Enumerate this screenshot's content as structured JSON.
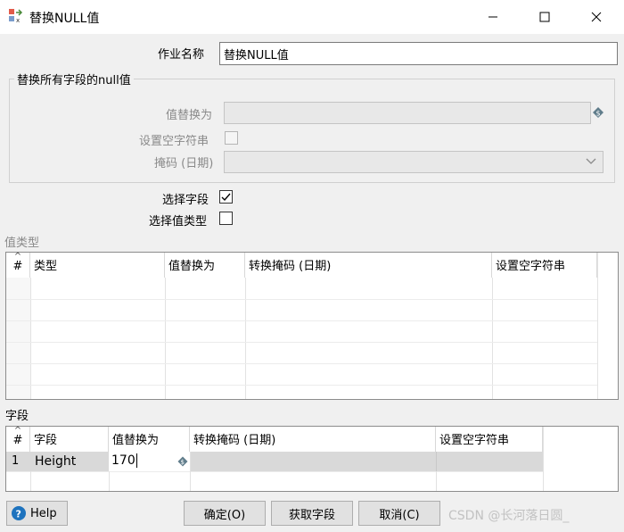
{
  "window": {
    "title": "替换NULL值",
    "icon": "pentaho-step-icon",
    "minimize_icon": "minimize-icon",
    "maximize_icon": "maximize-icon",
    "close_icon": "close-icon"
  },
  "job_name": {
    "label": "作业名称",
    "value": "替换NULL值"
  },
  "group_all_fields": {
    "legend": "替换所有字段的null值",
    "replace_value_label": "值替换为",
    "replace_value": "",
    "set_empty_label": "设置空字符串",
    "set_empty_checked": false,
    "mask_label": "掩码 (日期)",
    "mask_value": ""
  },
  "select_fields": {
    "label": "选择字段",
    "checked": true
  },
  "select_value_types": {
    "label": "选择值类型",
    "checked": false
  },
  "value_types_section": {
    "title": "值类型",
    "columns": [
      "#",
      "类型",
      "值替换为",
      "转换掩码 (日期)",
      "设置空字符串"
    ],
    "rows": []
  },
  "fields_section": {
    "title": "字段",
    "columns": [
      "#",
      "字段",
      "值替换为",
      "转换掩码 (日期)",
      "设置空字符串"
    ],
    "rows": [
      {
        "num": "1",
        "field": "Height",
        "replace": "170",
        "mask": "",
        "set_empty": ""
      }
    ]
  },
  "buttons": {
    "help": "Help",
    "ok": "确定(O)",
    "get_fields": "获取字段",
    "cancel": "取消(C)"
  },
  "watermark": "CSDN @长河落日圆_",
  "colors": {
    "selected_row": "#d9d9d9",
    "help_icon": "#1e73be"
  }
}
